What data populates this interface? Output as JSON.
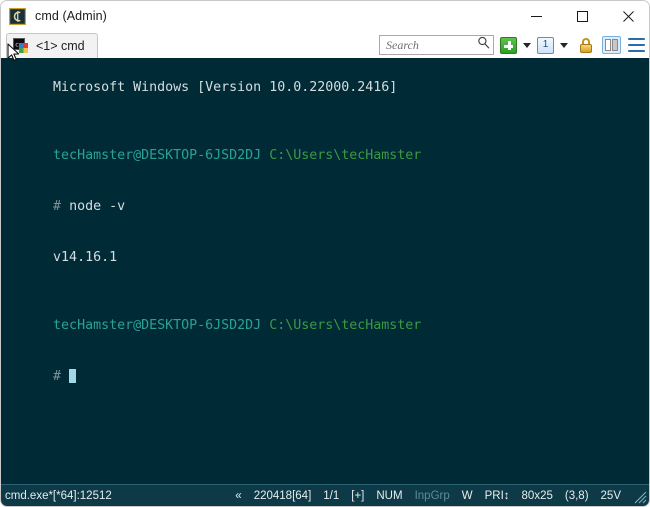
{
  "window": {
    "title": "cmd (Admin)",
    "app_icon": "conemu-icon",
    "controls": {
      "minimize": "—",
      "maximize": "□",
      "close": "✕"
    }
  },
  "tabbar": {
    "tabs": [
      {
        "label": "<1> cmd",
        "icon": "cmd-console-icon",
        "active": true
      }
    ],
    "toolbar": {
      "search": {
        "placeholder": "Search",
        "value": "",
        "icon": "search-icon"
      },
      "new_console": {
        "icon": "green-plus-icon",
        "dropdown": true
      },
      "active_console": {
        "label": "1",
        "icon": "console-number-icon",
        "dropdown": true
      },
      "lock": {
        "icon": "padlock-icon"
      },
      "split_panes": {
        "icon": "split-pane-icon"
      },
      "menu": {
        "icon": "hamburger-menu-icon"
      }
    }
  },
  "terminal": {
    "colors": {
      "background": "#002b36",
      "text": "#d5dde0",
      "prompt_user": "#2aa198",
      "prompt_path": "#3a9a44",
      "hash": "#7f9095",
      "cursor": "#9fd9e3"
    },
    "lines": [
      {
        "type": "plain",
        "text": "Microsoft Windows [Version 10.0.22000.2416]"
      },
      {
        "type": "blank",
        "text": ""
      },
      {
        "type": "prompt",
        "user": "tecHamster@DESKTOP-6JSD2DJ",
        "path": "C:\\Users\\tecHamster"
      },
      {
        "type": "command",
        "hash": "#",
        "text": " node -v"
      },
      {
        "type": "plain",
        "text": "v14.16.1"
      },
      {
        "type": "blank",
        "text": ""
      },
      {
        "type": "prompt",
        "user": "tecHamster@DESKTOP-6JSD2DJ",
        "path": "C:\\Users\\tecHamster"
      },
      {
        "type": "cursorline",
        "hash": "#",
        "text": " "
      }
    ]
  },
  "statusbar": {
    "process": "cmd.exe*[*64]:12512",
    "build_marker": "«",
    "build": "220418[64]",
    "pages": "1/1",
    "plus": "[+]",
    "num": "NUM",
    "inpgrp": "InpGrp",
    "w": "W",
    "pri": "PRI↕",
    "size": "80x25",
    "cursor_pos": "(3,8)",
    "scroll": "25V",
    "grip": "resize-grip-icon"
  }
}
